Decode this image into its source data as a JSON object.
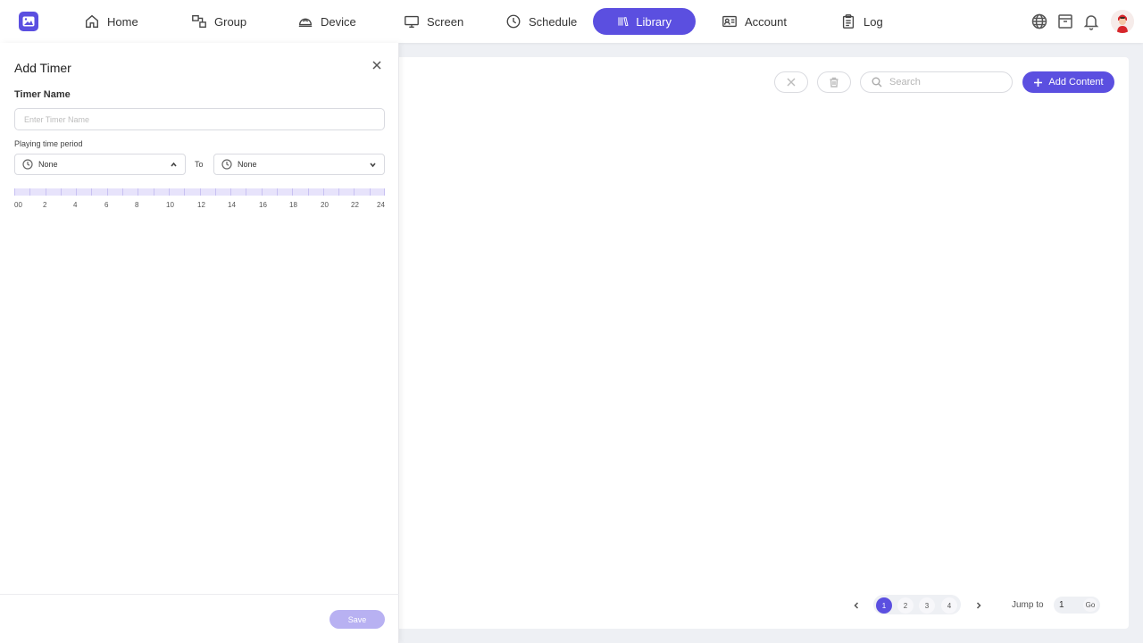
{
  "nav": {
    "items": [
      {
        "label": "Home",
        "icon": "home-icon"
      },
      {
        "label": "Group",
        "icon": "group-icon"
      },
      {
        "label": "Device",
        "icon": "device-icon"
      },
      {
        "label": "Screen",
        "icon": "screen-icon"
      },
      {
        "label": "Schedule",
        "icon": "clock-icon"
      },
      {
        "label": "Library",
        "icon": "library-icon",
        "active": true
      },
      {
        "label": "Account",
        "icon": "account-card-icon"
      },
      {
        "label": "Log",
        "icon": "clipboard-icon"
      }
    ],
    "right_icons": [
      "globe-icon",
      "archive-icon",
      "bell-icon"
    ]
  },
  "toolbar": {
    "search_placeholder": "Search",
    "add_content_label": "Add Content"
  },
  "pagination": {
    "pages": [
      "1",
      "2",
      "3",
      "4"
    ],
    "current": "1",
    "jump_label": "Jump to",
    "jump_value": "1",
    "go_label": "Go"
  },
  "drawer": {
    "title": "Add Timer",
    "timer_name_label": "Timer Name",
    "timer_name_placeholder": "Enter Timer Name",
    "timer_name_value": "",
    "period_label": "Playing time period",
    "from_value": "None",
    "to_label": "To",
    "to_value": "None",
    "timeline_labels": [
      "00",
      "2",
      "4",
      "6",
      "8",
      "10",
      "12",
      "14",
      "16",
      "18",
      "20",
      "22",
      "24"
    ],
    "save_label": "Save"
  },
  "colors": {
    "accent": "#5b4fe0",
    "accent_disabled": "#b8b1f2",
    "timeline_fill": "#e7e3fb",
    "page_bg": "#eef0f4"
  }
}
